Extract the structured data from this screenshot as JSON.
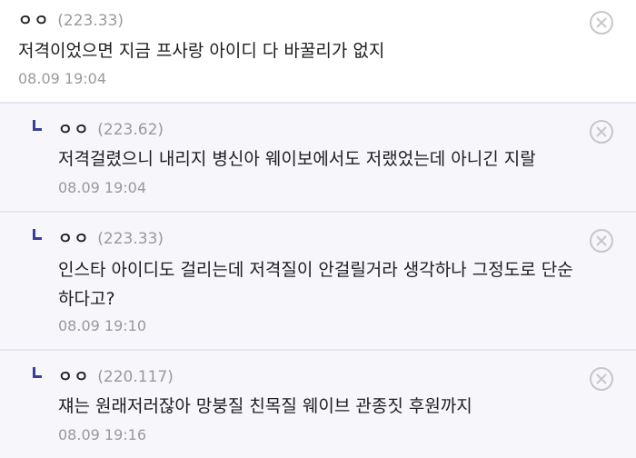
{
  "comments": [
    {
      "nickname": "ㅇㅇ",
      "ip": "(223.33)",
      "text": "저격이었으면 지금 프사랑 아이디 다 바꿀리가 없지",
      "date": "08.09 19:04",
      "is_reply": false
    },
    {
      "nickname": "ㅇㅇ",
      "ip": "(223.62)",
      "text": "저격걸렸으니 내리지 병신아 웨이보에서도 저랬었는데 아니긴 지랄",
      "date": "08.09 19:04",
      "is_reply": true
    },
    {
      "nickname": "ㅇㅇ",
      "ip": "(223.33)",
      "text_line1": "인스타 아이디도 걸리는데 저격질이 안걸릴거라 생각하나 그정도로 단순",
      "text_line2": "하다고?",
      "date": "08.09 19:10",
      "is_reply": true
    },
    {
      "nickname": "ㅇㅇ",
      "ip": "(220.117)",
      "text": "쟤는 원래저러잖아 망붕질 친목질 웨이브 관종짓 후원까지",
      "date": "08.09 19:16",
      "is_reply": true
    }
  ],
  "icons": {
    "delete": "close-circle-icon",
    "reply": "reply-arrow-icon"
  },
  "colors": {
    "reply_background": "#f6f6fb",
    "reply_mark": "#3a3f9a",
    "meta_text": "#9a9a9a"
  }
}
